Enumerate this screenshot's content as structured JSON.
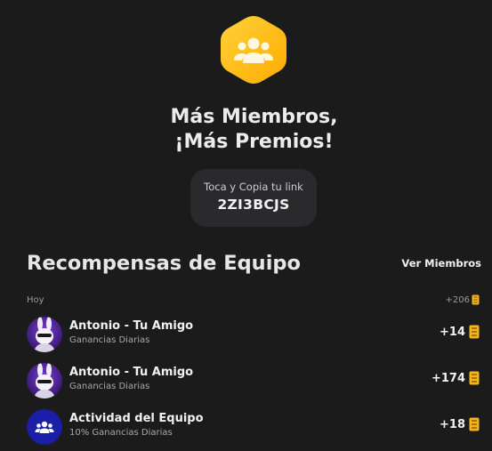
{
  "hero": {
    "icon": "team-icon",
    "title_line1": "Más Miembros,",
    "title_line2": "¡Más Premios!"
  },
  "invite": {
    "hint": "Toca y Copia tu link",
    "code": "2ZI3BCJS"
  },
  "section": {
    "title": "Recompensas de Equipo",
    "view_members": "Ver Miembros"
  },
  "day": {
    "label": "Hoy",
    "total": "+206"
  },
  "rewards": [
    {
      "name": "Antonio - Tu Amigo",
      "subtitle": "Ganancias Diarias",
      "amount": "+14",
      "avatar": "bunny-avatar"
    },
    {
      "name": "Antonio - Tu Amigo",
      "subtitle": "Ganancias Diarias",
      "amount": "+174",
      "avatar": "bunny-avatar"
    },
    {
      "name": "Actividad del Equipo",
      "subtitle": "10% Ganancias Diarias",
      "amount": "+18",
      "avatar": "team-icon"
    }
  ],
  "colors": {
    "background": "#1b1b1c",
    "badge_gold": "#ffc21a",
    "ticket_gold": "#f3b51c",
    "team_blue": "#1b1fa8"
  }
}
